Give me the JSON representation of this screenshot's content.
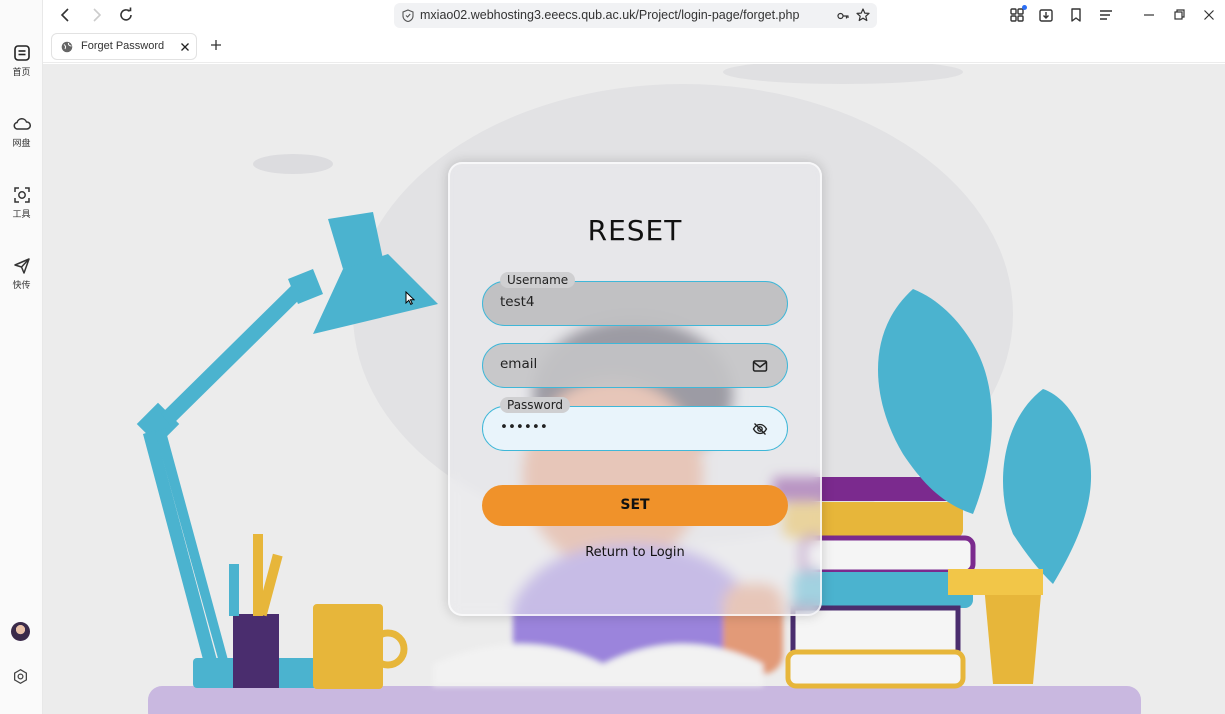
{
  "rail": {
    "items": [
      {
        "label": "首页",
        "icon": "home-card-icon"
      },
      {
        "label": "网盘",
        "icon": "cloud-icon"
      },
      {
        "label": "工具",
        "icon": "tools-icon"
      },
      {
        "label": "快传",
        "icon": "send-icon"
      }
    ]
  },
  "toolbar": {
    "url": "mxiao02.webhosting3.eeecs.qub.ac.uk/Project/login-page/forget.php"
  },
  "tab": {
    "title": "Forget Password"
  },
  "form": {
    "heading": "RESET",
    "username": {
      "tag": "Username",
      "value": "test4"
    },
    "email": {
      "placeholder": "email"
    },
    "password": {
      "tag": "Password",
      "value": "••••••"
    },
    "submit_label": "SET",
    "return_label": "Return to Login"
  },
  "colors": {
    "accent": "#f0922a",
    "field_border": "#3fb7d8",
    "lamp": "#4bb3cf"
  }
}
